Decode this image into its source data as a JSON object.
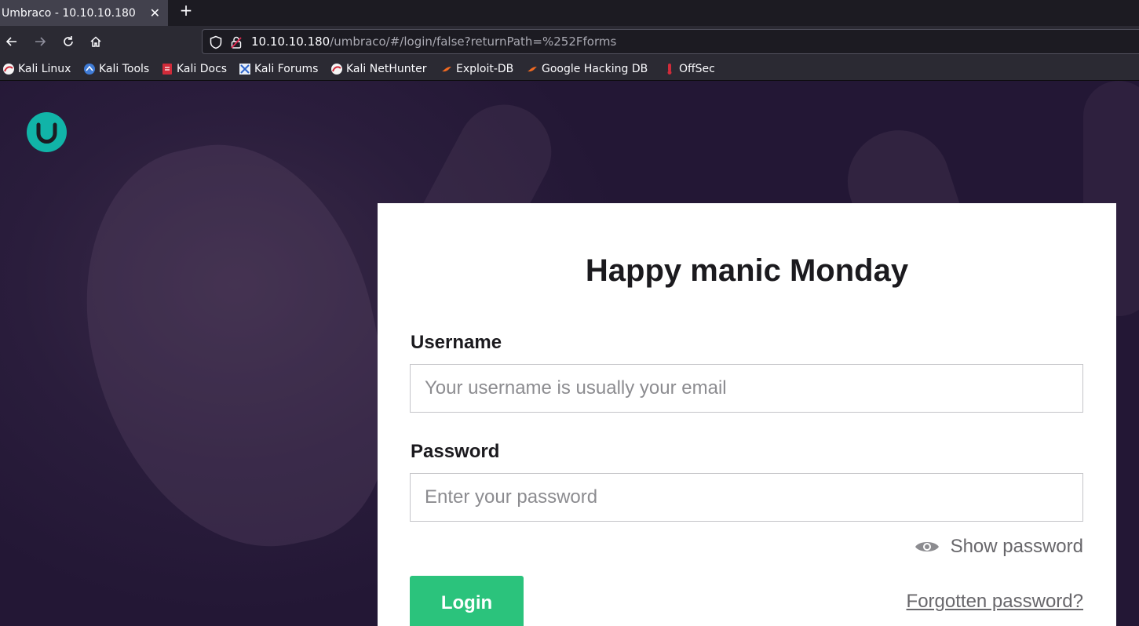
{
  "browser": {
    "tab": {
      "title": "Umbraco - 10.10.10.180",
      "close_glyph": "✕"
    },
    "new_tab_glyph": "+",
    "nav": {
      "back_icon": "arrow-left-icon",
      "forward_icon": "arrow-right-icon",
      "reload_icon": "reload-icon",
      "home_icon": "home-icon"
    },
    "url": {
      "host": "10.10.10.180",
      "path": "/umbraco/#/login/false?returnPath=%252Fforms"
    },
    "bookmarks": [
      {
        "label": "Kali Linux",
        "icon": "kali-dragon-icon"
      },
      {
        "label": "Kali Tools",
        "icon": "kali-tools-icon"
      },
      {
        "label": "Kali Docs",
        "icon": "kali-docs-icon"
      },
      {
        "label": "Kali Forums",
        "icon": "kali-forums-icon"
      },
      {
        "label": "Kali NetHunter",
        "icon": "kali-nethunter-icon"
      },
      {
        "label": "Exploit-DB",
        "icon": "exploit-db-icon"
      },
      {
        "label": "Google Hacking DB",
        "icon": "ghdb-icon"
      },
      {
        "label": "OffSec",
        "icon": "offsec-icon"
      }
    ]
  },
  "login": {
    "greeting": "Happy manic Monday",
    "username_label": "Username",
    "username_placeholder": "Your username is usually your email",
    "password_label": "Password",
    "password_placeholder": "Enter your password",
    "show_password": "Show password",
    "login_button": "Login",
    "forgot_password": "Forgotten password?"
  },
  "colors": {
    "accent_teal": "#11b4a8",
    "login_green": "#2bc37c",
    "background_purple": "#2a1d3c"
  }
}
